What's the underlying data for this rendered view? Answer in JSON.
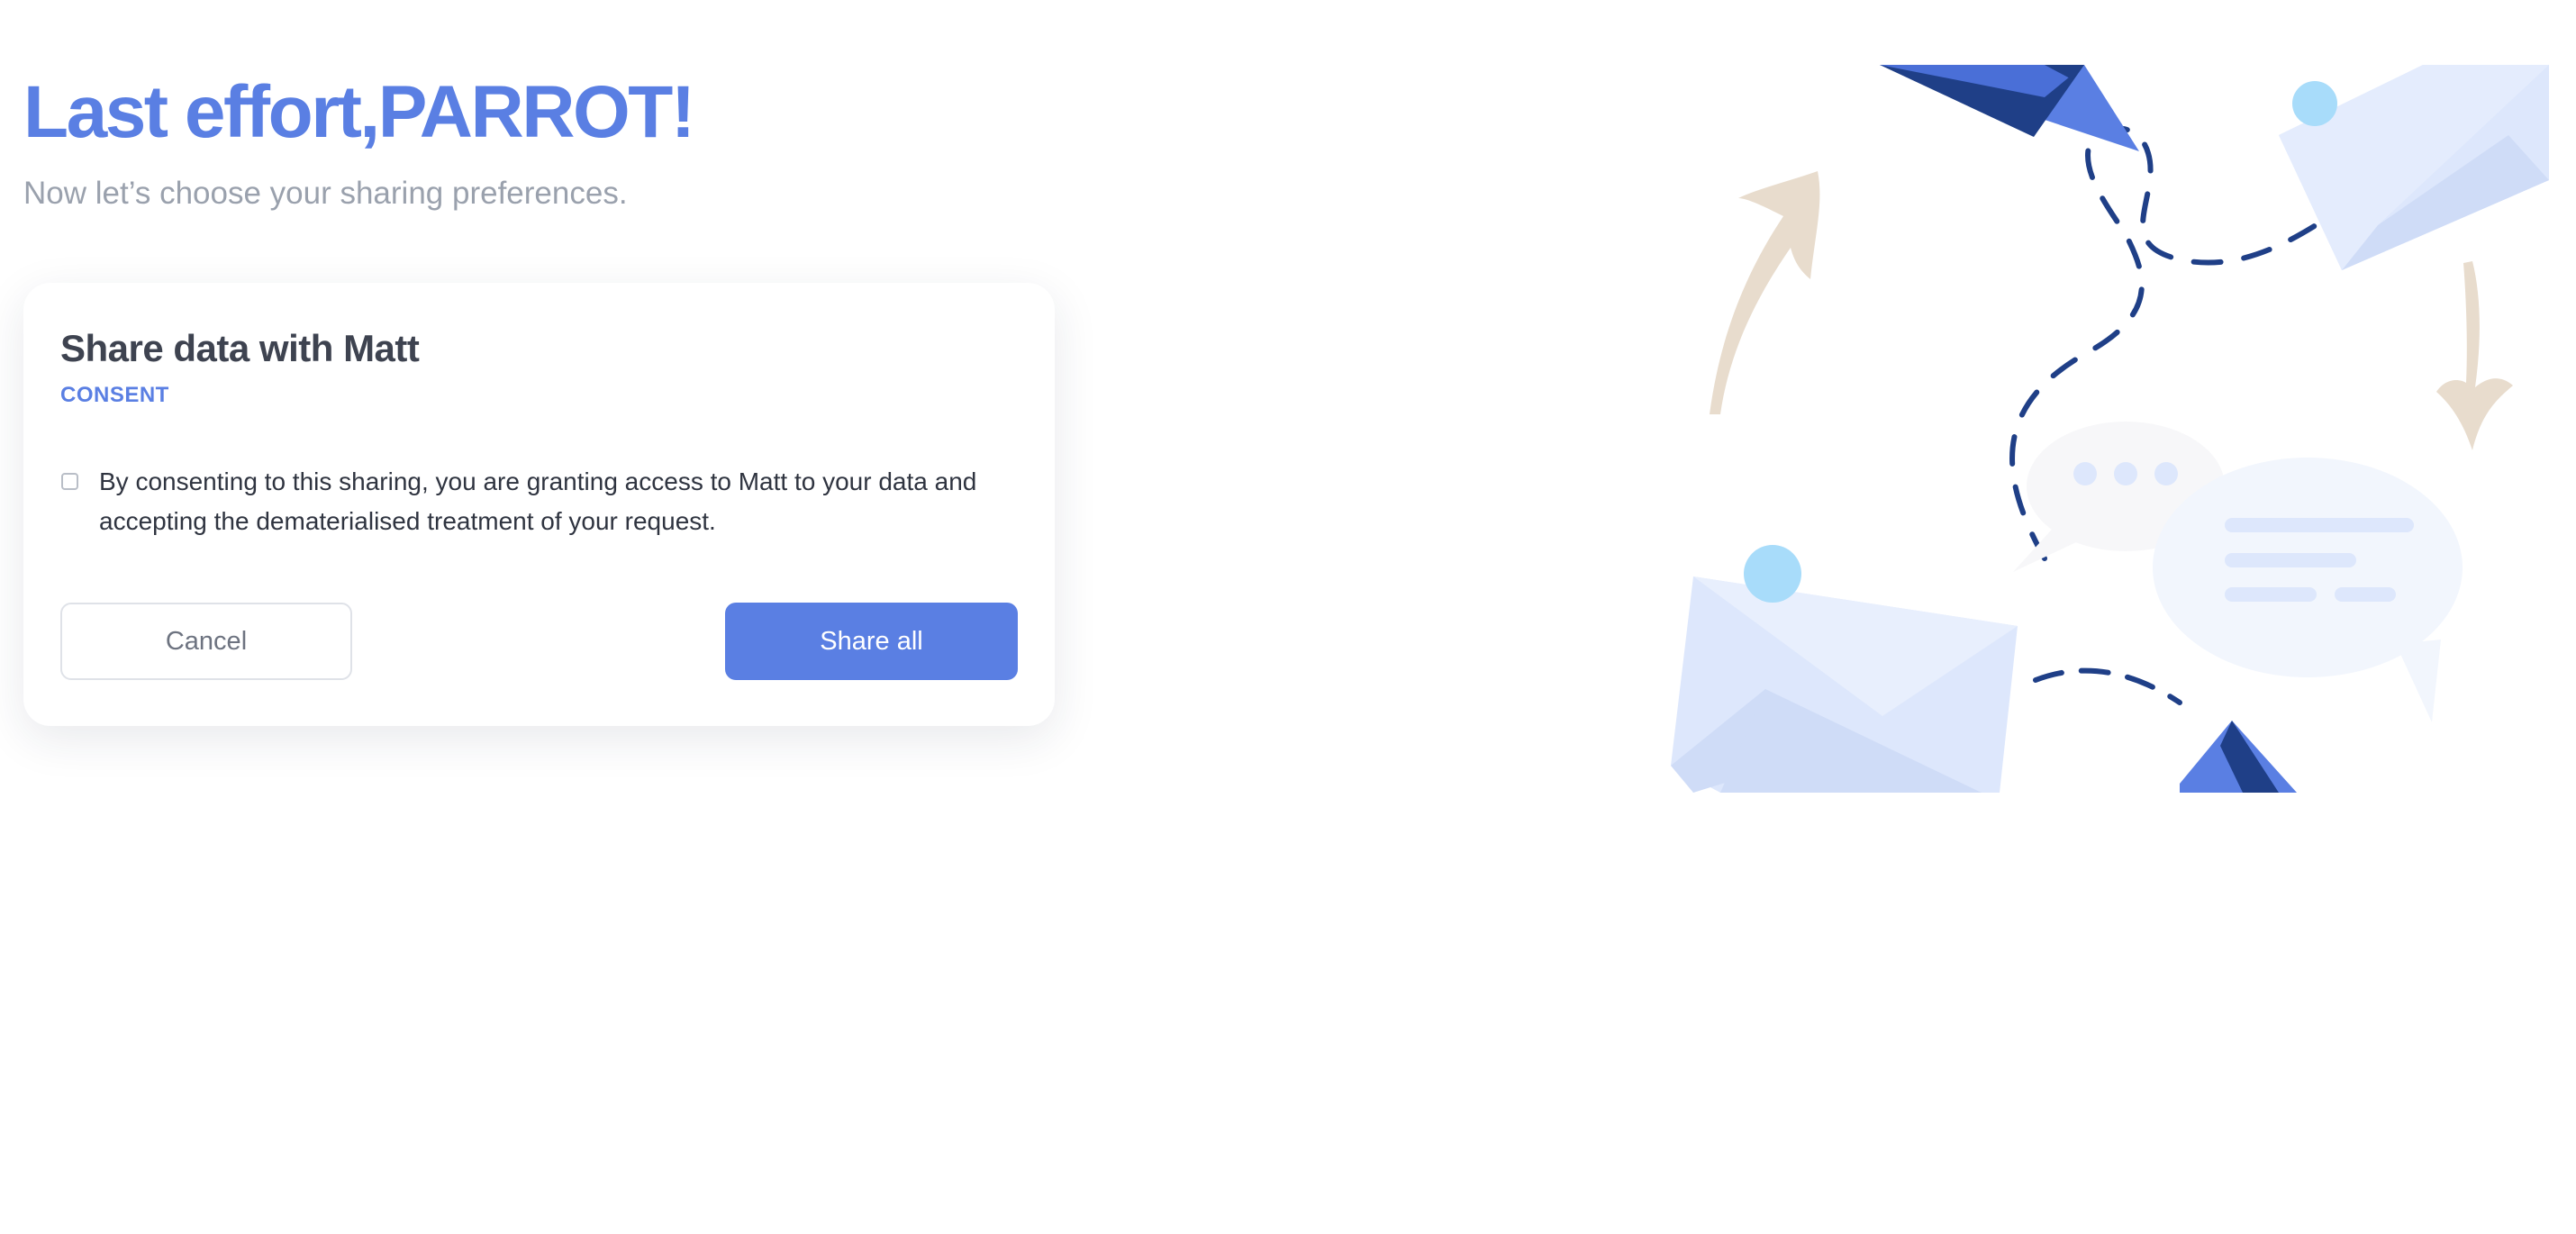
{
  "header": {
    "title": "Last effort,PARROT!",
    "subtitle": "Now let’s choose your sharing preferences."
  },
  "card": {
    "title": "Share data with Matt",
    "tag": "CONSENT",
    "consent_text": "By consenting to this sharing, you are granting access to Matt to your data and accepting the dematerialised treatment of your request.",
    "consent_checked": false,
    "cancel_label": "Cancel",
    "share_label": "Share all"
  },
  "illustration": {
    "icons": [
      "paper-plane-icon",
      "envelope-icon",
      "chat-bubble-icon",
      "arrow-icon"
    ]
  },
  "colors": {
    "accent": "#5a7fe3",
    "title_text": "#3e4350",
    "muted_text": "#9aa1ad",
    "dash_line": "#1f3f87",
    "envelope_light": "#dde7fc",
    "sand_arrow": "#e8dccd"
  }
}
